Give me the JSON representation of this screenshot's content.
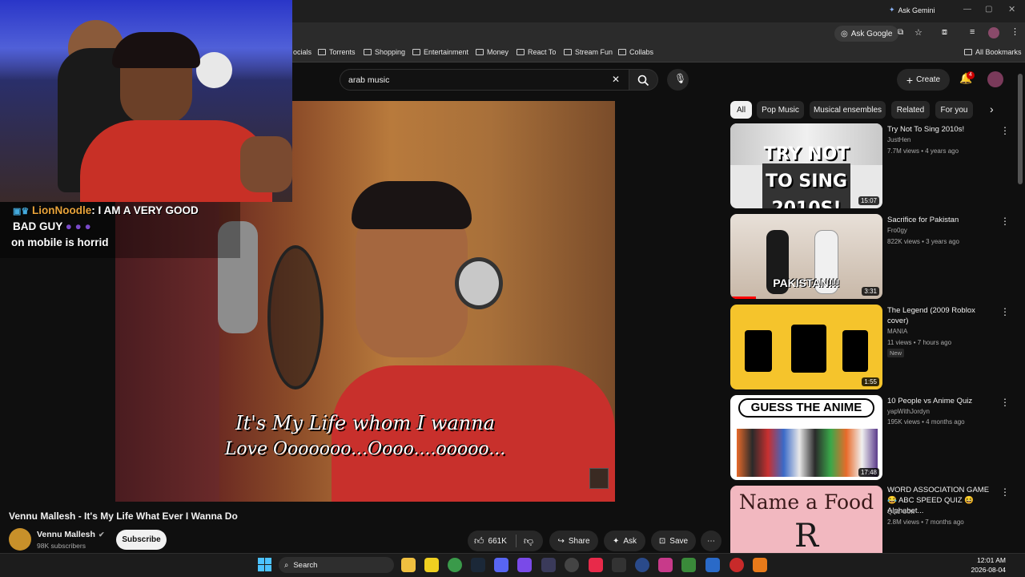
{
  "browser": {
    "ask_gemini": "Ask Gemini",
    "ask_google": "Ask Google",
    "bookmarks": [
      "ocials",
      "Torrents",
      "Shopping",
      "Entertainment",
      "Money",
      "React To",
      "Stream Fun",
      "Collabs"
    ],
    "all_bookmarks": "All Bookmarks"
  },
  "youtube": {
    "search_value": "arab music",
    "create_label": "Create",
    "notification_count": "4",
    "chips": [
      "All",
      "Pop Music",
      "Musical ensembles",
      "Related",
      "For you"
    ],
    "video": {
      "caption_line1": "It's My Life whom I wanna",
      "caption_line2": "Love Ooooooo...Oooo....ooooo...",
      "title": "Vennu Mallesh - It's My Life What Ever I Wanna Do",
      "channel": "Vennu Mallesh",
      "subscribers": "98K subscribers",
      "subscribe_label": "Subscribe",
      "likes": "661K",
      "share_label": "Share",
      "ask_label": "Ask",
      "save_label": "Save"
    },
    "recommendations": [
      {
        "title": "Try Not To Sing 2010s!",
        "channel": "JustHen",
        "meta": "7.7M views • 4 years ago",
        "duration": "15:07",
        "thumb_text": "TRY NOT TO SING 2010S!"
      },
      {
        "title": "Sacrifice for Pakistan",
        "channel": "Fro0gy",
        "meta": "822K views • 3 years ago",
        "duration": "3:31",
        "thumb_text": "PAKISTAN!!!"
      },
      {
        "title": "The Legend (2009 Roblox cover)",
        "channel": "MANIA",
        "meta": "11 views • 7 hours ago",
        "badge": "New",
        "duration": "1:55"
      },
      {
        "title": "10 People vs Anime Quiz",
        "channel": "yapWithJordyn",
        "meta": "195K views • 4 months ago",
        "duration": "17:48",
        "thumb_text": "GUESS THE ANIME"
      },
      {
        "title": "WORD ASSOCIATION GAME 😂 ABC SPEED QUIZ 😆 Alphabet...",
        "channel": "Quiz Cow",
        "meta": "2.8M views • 7 months ago",
        "thumb_text_1": "Name a Food",
        "thumb_text_2": "R"
      }
    ]
  },
  "stream_chat": {
    "username": "LionNoodle",
    "message_line1": ": I AM A VERY GOOD",
    "message_line2": "BAD GUY",
    "message_line3": "on mobile is horrid"
  },
  "taskbar": {
    "search_label": "Search",
    "time": "12:01 AM",
    "date": "2026-08-04"
  },
  "colors": {
    "youtube_red": "#ff0000",
    "chat_user": "#e8a33a",
    "thumb3_bg": "#f5c42c"
  }
}
